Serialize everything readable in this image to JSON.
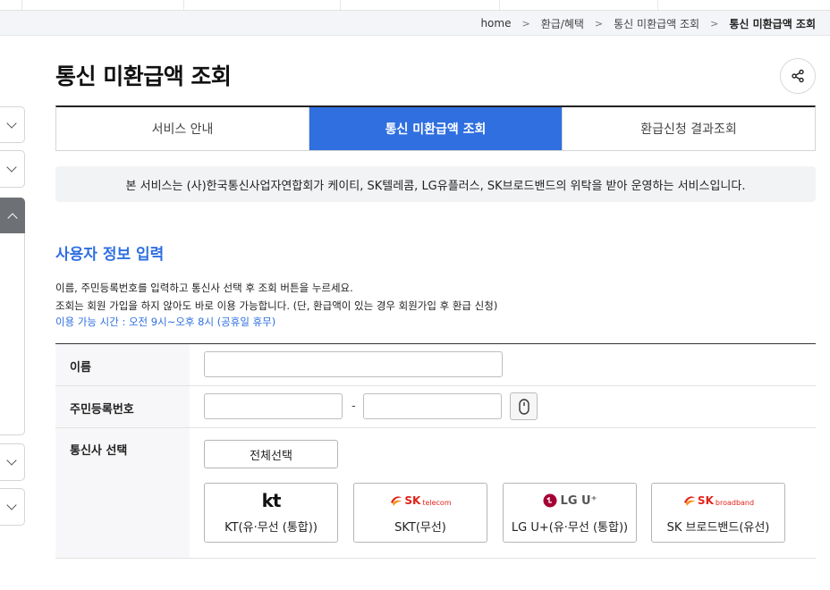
{
  "breadcrumb": {
    "items": [
      "home",
      "환급/혜택",
      "통신 미환급액 조회",
      "통신 미환급액 조회"
    ]
  },
  "page": {
    "title": "통신 미환급액 조회"
  },
  "tabs": [
    {
      "label": "서비스 안내",
      "active": false
    },
    {
      "label": "통신 미환급액 조회",
      "active": true
    },
    {
      "label": "환급신청 결과조회",
      "active": false
    }
  ],
  "notice": {
    "text": "본 서비스는 (사)한국통신사업자연합회가 케이티, SK텔레콤, LG유플러스, SK브로드밴드의 위탁을 받아 운영하는 서비스입니다."
  },
  "section": {
    "title": "사용자 정보 입력",
    "desc_line1": "이름, 주민등록번호를 입력하고 통신사 선택 후 조회 버튼을 누르세요.",
    "desc_line2": "조회는 회원 가입을 하지 않아도 바로 이용 가능합니다. (단, 환급액이 있는 경우 회원가입 후 환급 신청)",
    "hours": "이용 가능 시간 : 오전 9시~오후 8시 (공휴일 휴무)"
  },
  "form": {
    "name_label": "이름",
    "name_value": "",
    "rrn_label": "주민등록번호",
    "rrn_front_value": "",
    "rrn_back_value": "",
    "rrn_separator": "-",
    "carrier_label": "통신사 선택",
    "select_all_label": "전체선택",
    "carriers": [
      {
        "logo": "kt",
        "name": "KT(유·무선 (통합))"
      },
      {
        "logo_main": "SK",
        "logo_sub": "telecom",
        "name": "SKT(무선)"
      },
      {
        "logo": "LG U⁺",
        "name": "LG U+(유·무선 (통합))"
      },
      {
        "logo_main": "SK",
        "logo_sub": "broadband",
        "name": "SK 브로드밴드(유선)"
      }
    ]
  },
  "icons": {
    "share": "share-icon",
    "keypad": "secure-keypad-icon",
    "chevron": "chevron-down-icon"
  },
  "colors": {
    "accent": "#2f6fe0",
    "sk_red": "#e2231a",
    "sk_orange": "#f7941d",
    "lg_red": "#a50034"
  }
}
